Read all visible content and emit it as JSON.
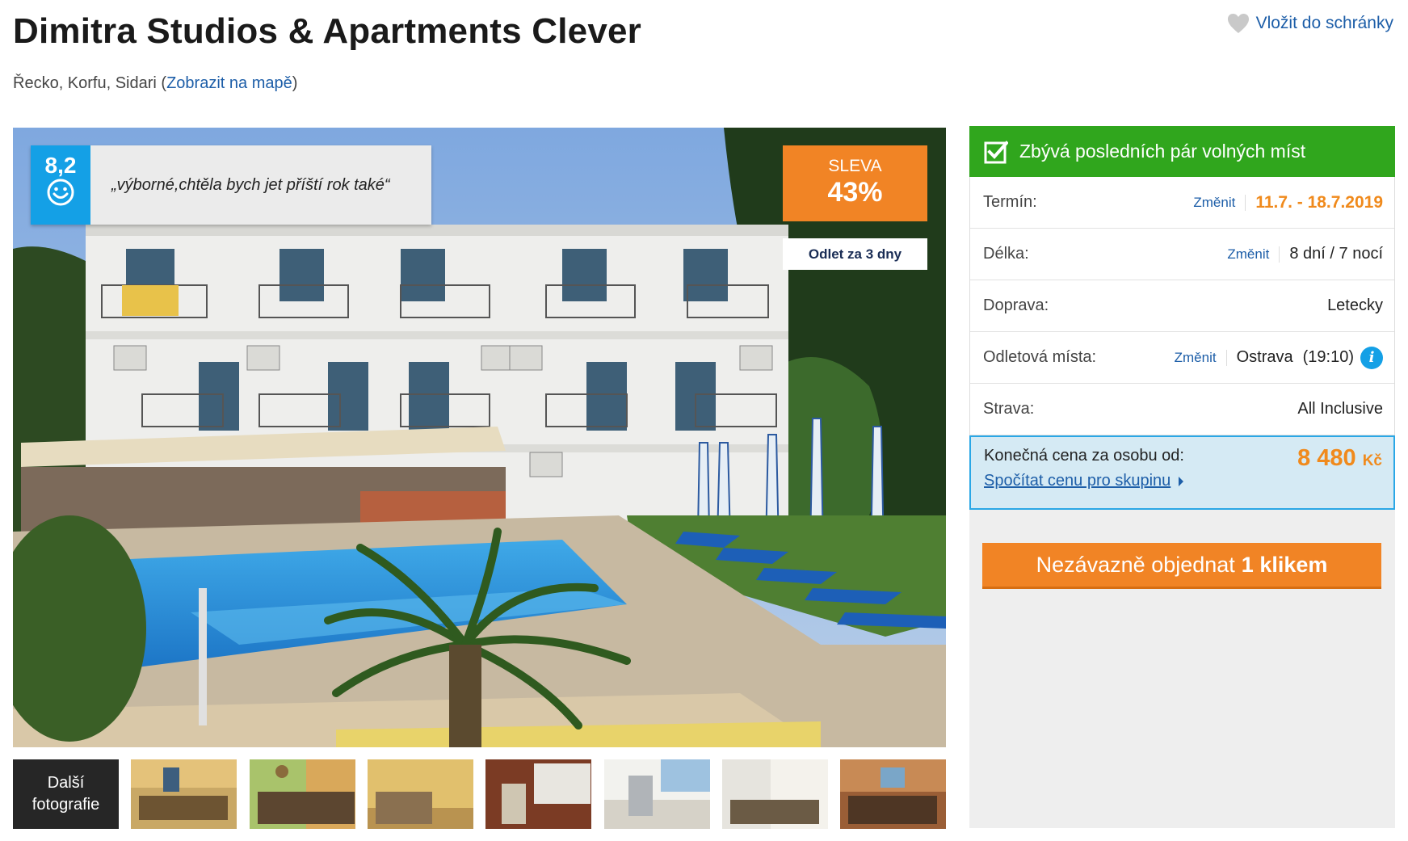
{
  "header": {
    "title": "Dimitra Studios & Apartments Clever",
    "wishlist_label": "Vložit do schránky"
  },
  "location": {
    "text": "Řecko, Korfu, Sidari",
    "open_paren": "(",
    "map_link": "Zobrazit na mapě",
    "close_paren": ")"
  },
  "photo": {
    "rating_score": "8,2",
    "rating_icon": "smiley-icon",
    "review_quote": "„výborné,chtěla bych jet příští rok také“",
    "discount_label": "SLEVA",
    "discount_value": "43%",
    "departure_badge": "Odlet za 3 dny"
  },
  "gallery": {
    "more_photos_line1": "Další",
    "more_photos_line2": "fotografie"
  },
  "booking": {
    "availability": "Zbývá posledních pár volných míst",
    "rows": [
      {
        "label": "Termín:",
        "change": "Změnit",
        "value": "11.7. - 18.7.2019"
      },
      {
        "label": "Délka:",
        "change": "Změnit",
        "value": "8 dní / 7 nocí"
      },
      {
        "label": "Doprava:",
        "value": "Letecky"
      },
      {
        "label": "Odletová místa:",
        "change": "Změnit",
        "value": "Ostrava",
        "time": "(19:10)"
      },
      {
        "label": "Strava:",
        "value": "All Inclusive"
      }
    ],
    "price_label": "Konečná cena za osobu od:",
    "price_value": "8 480",
    "price_currency": "Kč",
    "group_link": "Spočítat cenu pro skupinu",
    "order_button": "Nezávazně objednat",
    "order_button_bold": "1 klikem"
  },
  "colors": {
    "accent_blue": "#14a0e6",
    "link_blue": "#1d5ea8",
    "orange": "#f18425",
    "green": "#30a61d"
  }
}
